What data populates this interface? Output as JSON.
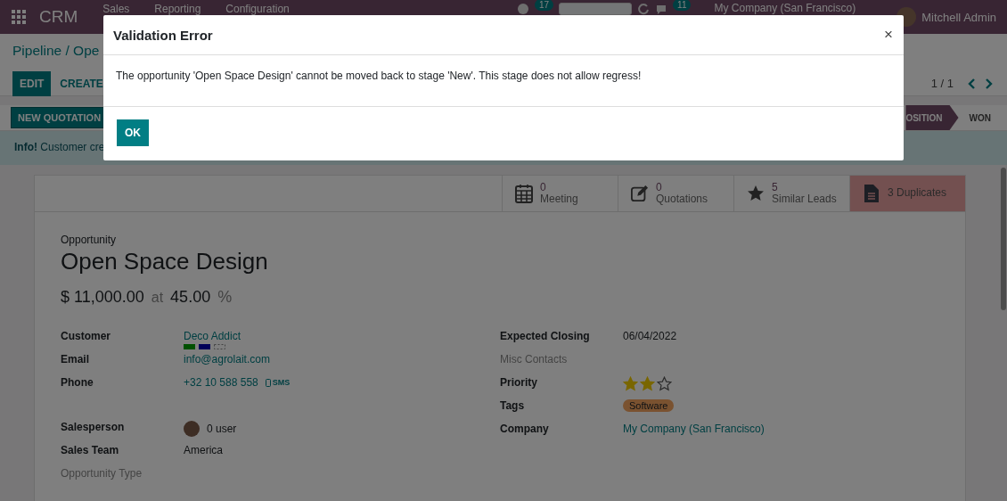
{
  "navbar": {
    "app": "CRM",
    "menu": [
      "Sales",
      "Reporting",
      "Configuration"
    ],
    "badges": [
      "17",
      "11"
    ],
    "company": "My Company (San Francisco)",
    "user": "Mitchell Admin"
  },
  "breadcrumb": "Pipeline / Ope",
  "actions": [
    "EDIT",
    "CREATE"
  ],
  "pager": "1 / 1",
  "header_button": "NEW QUOTATION",
  "stages": [
    {
      "label": "OSITION",
      "selected": true
    },
    {
      "label": "WON",
      "selected": false
    }
  ],
  "alert": {
    "title": "Info!",
    "text": "Customer cre"
  },
  "smart_buttons": [
    {
      "kind": "meeting",
      "count": "0",
      "label": "Meeting"
    },
    {
      "kind": "quote",
      "count": "0",
      "label": "Quotations"
    },
    {
      "kind": "star",
      "count": "5",
      "label": "Similar Leads"
    },
    {
      "kind": "duplicates",
      "label": "3 Duplicates"
    }
  ],
  "form": {
    "type_label": "Opportunity",
    "name": "Open Space Design",
    "revenue": "$ 11,000.00",
    "at": "at",
    "probability": "45.00",
    "percent": "%",
    "left": [
      {
        "label": "Customer",
        "value": "Deco Addict",
        "kind": "partner"
      },
      {
        "label": "Email",
        "value": "info@agrolait.com",
        "kind": "link"
      },
      {
        "label": "Phone",
        "value": "+32 10 588 558",
        "kind": "phone",
        "sms": "SMS"
      },
      {
        "kind": "gap"
      },
      {
        "label": "Salesperson",
        "value": "0 user",
        "kind": "user"
      },
      {
        "label": "Sales Team",
        "value": "America",
        "kind": "text"
      },
      {
        "label": "Opportunity Type",
        "kind": "empty"
      }
    ],
    "right": [
      {
        "label": "Expected Closing",
        "value": "06/04/2022",
        "kind": "text"
      },
      {
        "label": "Misc Contacts",
        "kind": "empty"
      },
      {
        "label": "Priority",
        "kind": "stars",
        "stars": 2
      },
      {
        "label": "Tags",
        "value": "Software",
        "kind": "tag"
      },
      {
        "label": "Company",
        "value": "My Company (San Francisco)",
        "kind": "link"
      }
    ]
  },
  "dialog": {
    "title": "Validation Error",
    "close": "×",
    "message": "The opportunity 'Open Space Design' cannot be moved back to stage 'New'. This stage does not allow regress!",
    "button": "OK"
  }
}
